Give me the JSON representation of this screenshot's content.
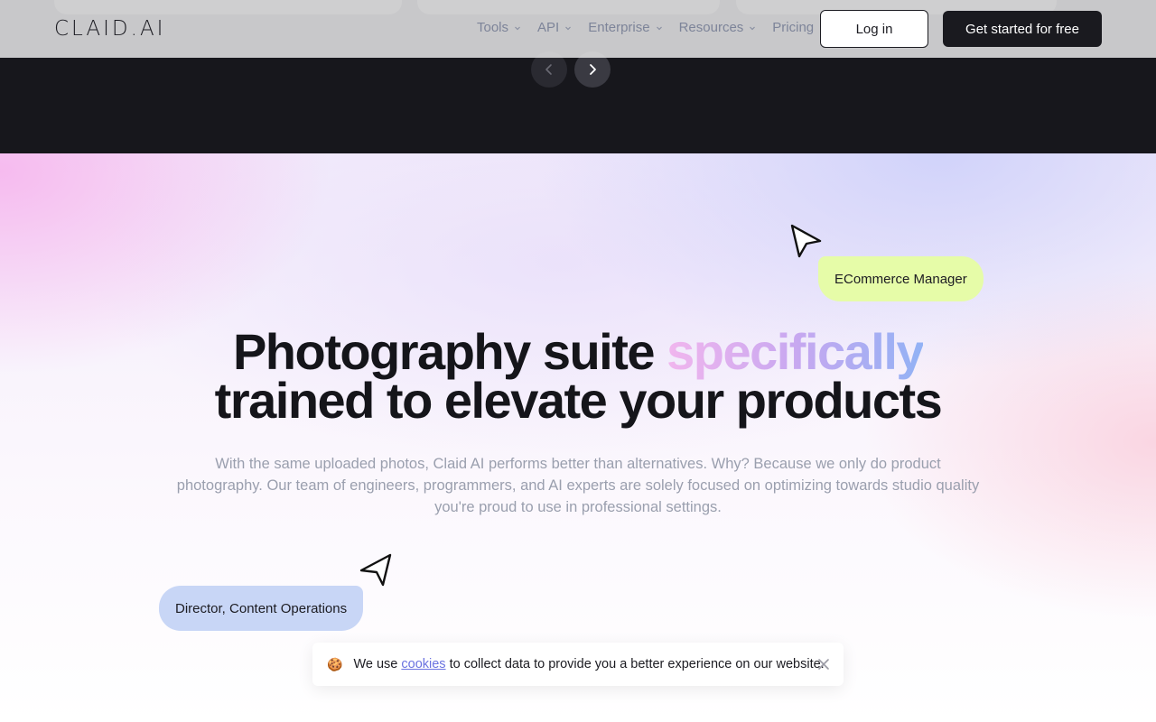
{
  "header": {
    "logo": "CLAID.AI",
    "nav": [
      {
        "label": "Tools",
        "has_dropdown": true
      },
      {
        "label": "API",
        "has_dropdown": true
      },
      {
        "label": "Enterprise",
        "has_dropdown": true
      },
      {
        "label": "Resources",
        "has_dropdown": true
      },
      {
        "label": "Pricing",
        "has_dropdown": false
      }
    ],
    "login_label": "Log in",
    "cta_label": "Get started for free"
  },
  "carousel": {
    "ghost_text": "",
    "prev_icon": "chevron-left-icon",
    "next_icon": "chevron-right-icon"
  },
  "hero": {
    "headline_part1": "Photography suite ",
    "headline_highlight": "specifically",
    "headline_part2": "trained to elevate your products",
    "subtext": "With the same uploaded photos, Claid AI performs better than alternatives. Why? Because we only do product photography. Our team of engineers, programmers, and AI experts are solely focused on optimizing towards studio quality you're proud to use in professional settings.",
    "tag_top": "ECommerce Manager",
    "tag_bottom": "Director, Content Operations"
  },
  "cookie_banner": {
    "emoji": "🍪",
    "prefix": "We use ",
    "link_text": "cookies",
    "suffix": " to collect data to provide you a better experience on our website.",
    "close_icon": "close-icon"
  },
  "colors": {
    "dark_band": "#17171c",
    "tag_top_bg": "#e6fca8",
    "tag_bottom_bg": "#c8d6f6",
    "cta_bg": "#1a1a1f",
    "link": "#6b73e0"
  }
}
